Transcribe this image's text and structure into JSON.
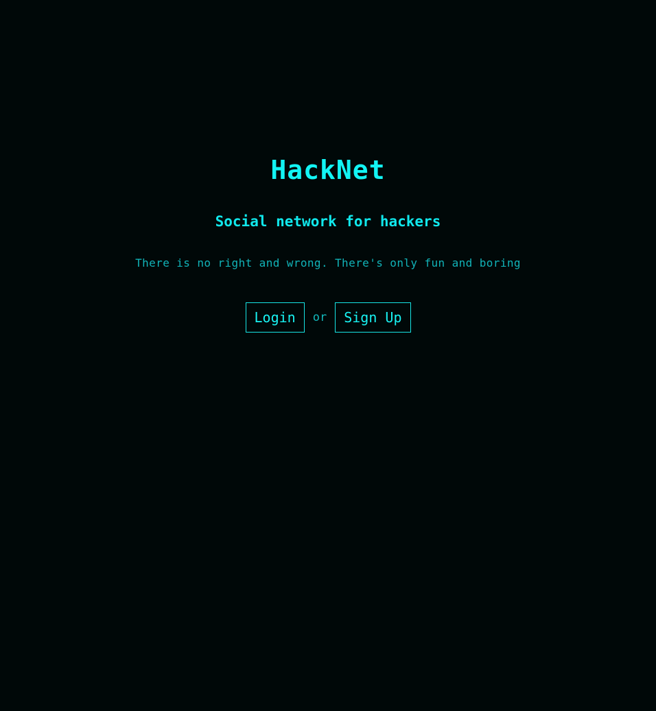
{
  "app": {
    "title": "HackNet",
    "subtitle": "Social network for hackers",
    "tagline": "There is no right and wrong. There's only fun and boring"
  },
  "actions": {
    "login_label": "Login",
    "separator": "or",
    "signup_label": "Sign Up"
  },
  "colors": {
    "background": "#000808",
    "accent": "#12f4f4",
    "muted": "#11b3b8"
  }
}
